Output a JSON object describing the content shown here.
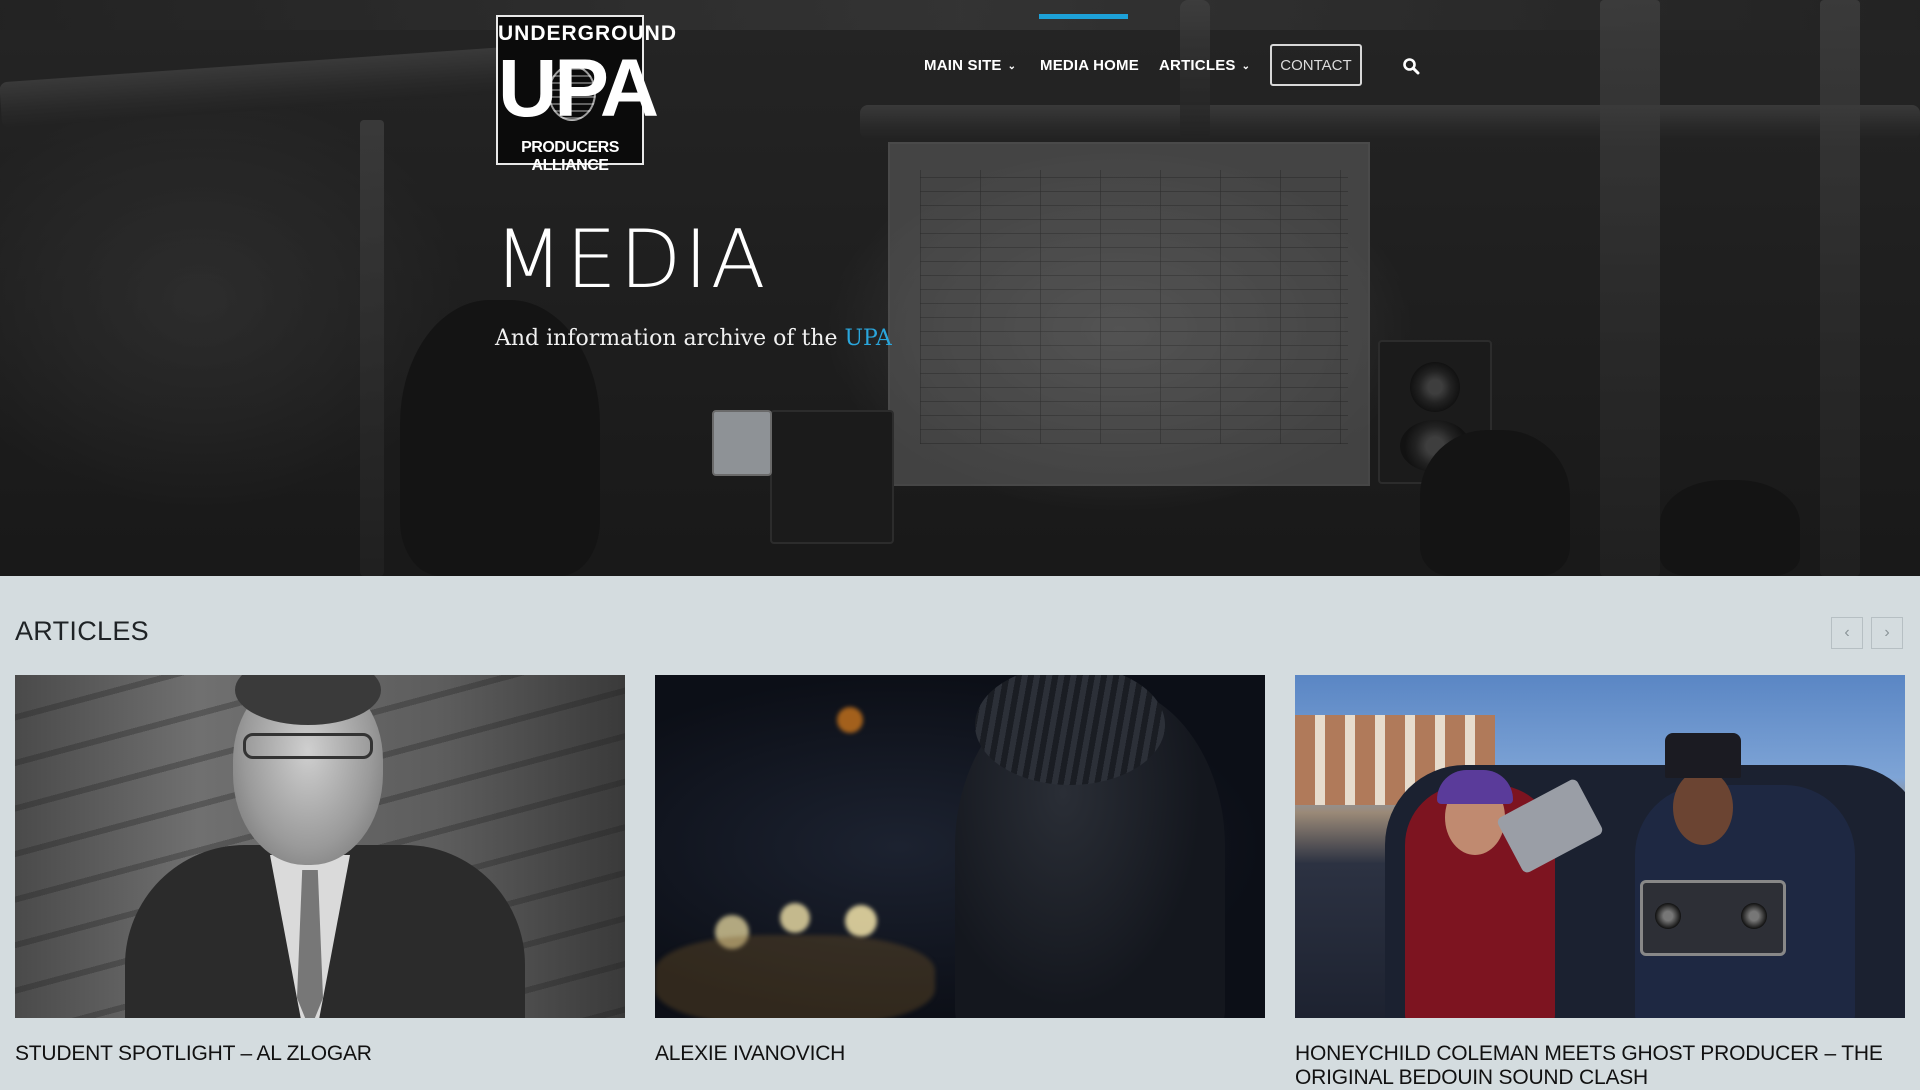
{
  "logo": {
    "top_text": "UNDERGROUND",
    "main_text": "UPA",
    "bottom_text": "PRODUCERS ALLIANCE"
  },
  "nav": {
    "items": [
      {
        "label": "MAIN SITE",
        "has_dropdown": true
      },
      {
        "label": "MEDIA HOME",
        "has_dropdown": false,
        "active": true
      },
      {
        "label": "ARTICLES",
        "has_dropdown": true
      }
    ],
    "contact_label": "CONTACT",
    "search_icon": "search-icon",
    "dropdown_icon": "chevron-down-icon",
    "accent_color": "#1da1d8"
  },
  "hero": {
    "title": "MEDIA",
    "subtitle_prefix": "And information archive of the ",
    "subtitle_accent": "UPA"
  },
  "articles": {
    "section_title": "ARTICLES",
    "prev_icon": "chevron-left-icon",
    "next_icon": "chevron-right-icon",
    "items": [
      {
        "title": "STUDENT SPOTLIGHT – AL ZLOGAR"
      },
      {
        "title": "ALEXIE IVANOVICH"
      },
      {
        "title": "HONEYCHILD COLEMAN MEETS GHOST PRODUCER – THE ORIGINAL BEDOUIN SOUND CLASH"
      }
    ]
  },
  "glyphs": {
    "chevron_down": "⌄",
    "chevron_left": "‹",
    "chevron_right": "›"
  }
}
